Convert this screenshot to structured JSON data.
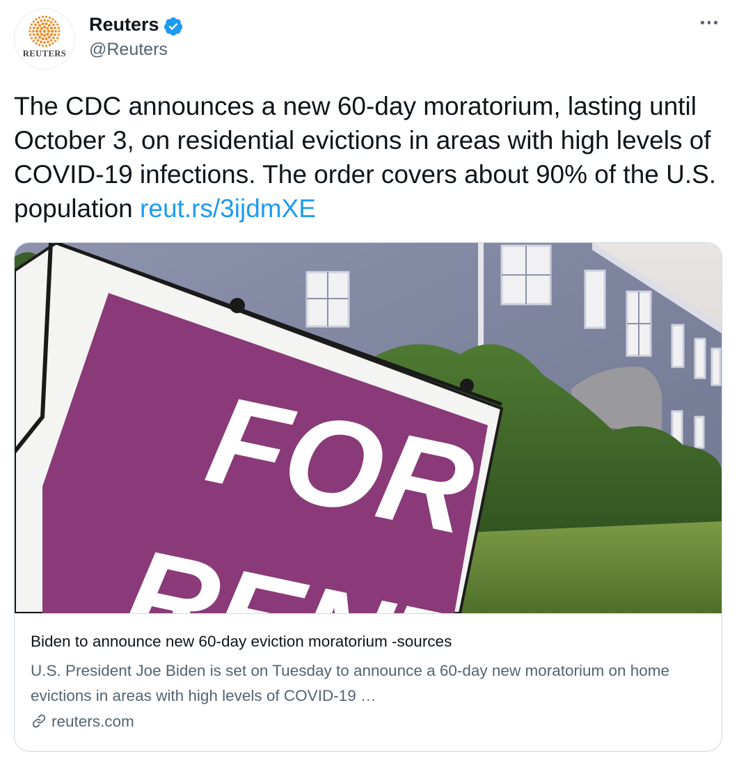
{
  "author": {
    "name": "Reuters",
    "handle": "@Reuters",
    "avatar_text": "REUTERS",
    "verified": true
  },
  "tweet": {
    "text": "The CDC announces a new 60-day moratorium, lasting until October 3, on residential evictions in areas with high levels of COVID-19 infections. The order covers about 90% of the U.S. population",
    "link": "reut.rs/3ijdmXE"
  },
  "card": {
    "image_sign_line1": "FOR",
    "image_sign_line2": "RENT",
    "title": "Biden to announce new 60-day eviction moratorium -sources",
    "description": "U.S. President Joe Biden is set on Tuesday to announce a 60-day new moratorium on home evictions in areas with high levels of COVID-19 …",
    "domain": "reuters.com"
  },
  "colors": {
    "link": "#1d9bf0",
    "verified": "#1d9bf0",
    "reuters_orange": "#f08a24",
    "sign_purple": "#8a3a78"
  },
  "icons": {
    "verified": "verified-badge-icon",
    "more": "more-options-icon",
    "link": "link-icon"
  }
}
